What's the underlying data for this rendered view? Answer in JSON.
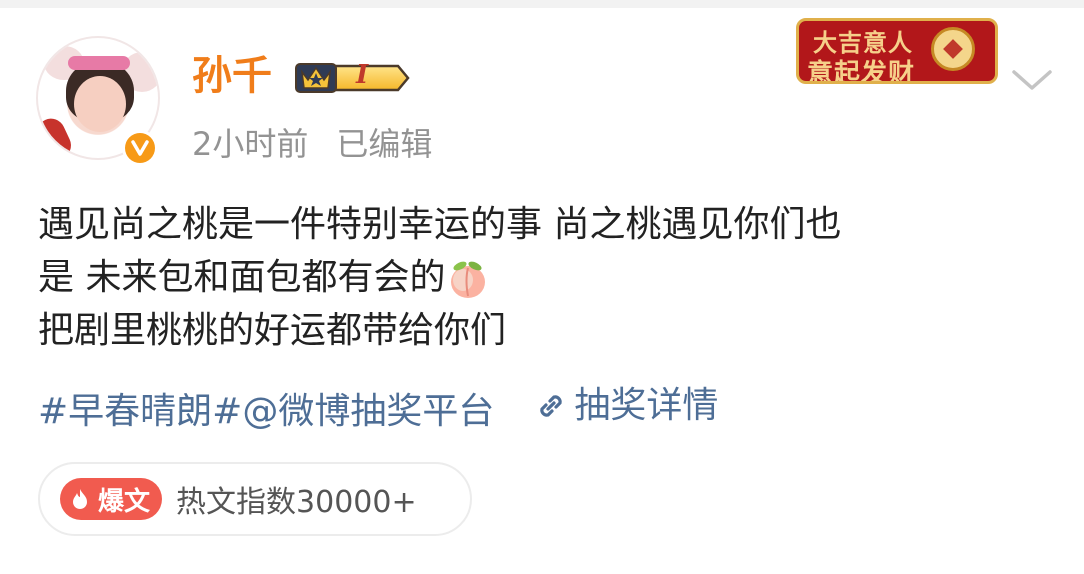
{
  "user": {
    "name": "孙千",
    "level": "I",
    "time": "2小时前",
    "edited": "已编辑"
  },
  "sticker": {
    "line1": "大吉意人",
    "line2": "意起发财"
  },
  "post": {
    "line1": "遇见尚之桃是一件特别幸运的事 尚之桃遇见你们也",
    "line2": "是 未来包和面包都有会的",
    "line3": "把剧里桃桃的好运都带给你们",
    "emoji": "peach",
    "hashtag": "#早春晴朗#",
    "mention": "@微博抽奖平台",
    "link": "抽奖详情"
  },
  "hot": {
    "badge": "爆文",
    "label": "热文指数30000+"
  },
  "colors": {
    "username": "#f07d1a",
    "link": "#4e6e96",
    "hot": "#f15b4f",
    "verified": "#f79a17"
  }
}
